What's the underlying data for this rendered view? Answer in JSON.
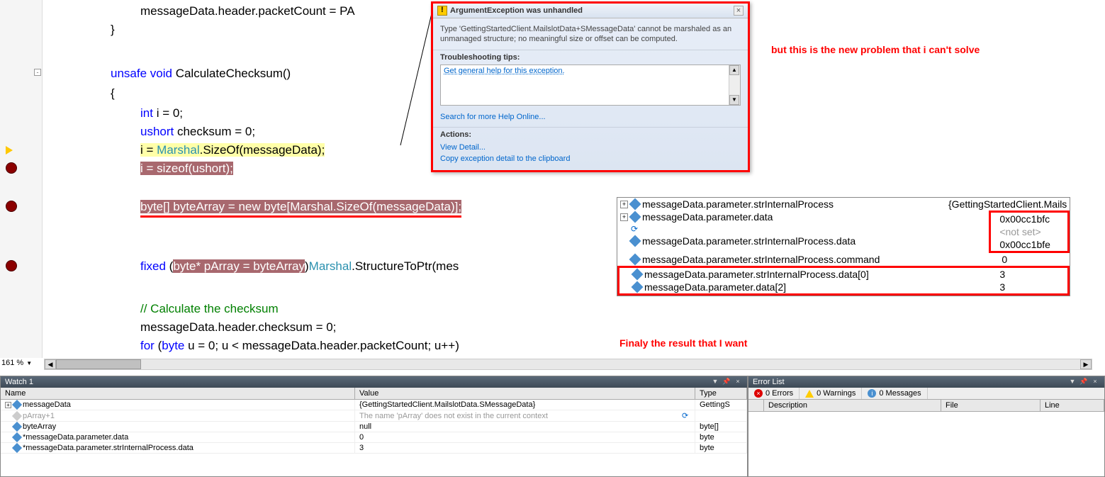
{
  "code": {
    "l1": "messageData.header.packetCount = PA",
    "l2": "}",
    "l3_kw1": "unsafe",
    "l3_kw2": "void",
    "l3_name": " CalculateChecksum()",
    "l4": "{",
    "l5_kw": "int",
    "l5_rest": " i = 0;",
    "l6_kw": "ushort",
    "l6_rest": " checksum = 0;",
    "l7_a": "i = ",
    "l7_b": "Marshal",
    "l7_c": ".SizeOf(messageData);",
    "l8_a": "i",
    "l8_b": " = ",
    "l8_c": "sizeof",
    "l8_d": "(",
    "l8_e": "ushort",
    "l8_f": ");",
    "l9_a": "byte",
    "l9_b": "[] byteArray = ",
    "l9_c": "new",
    "l9_d": " ",
    "l9_e": "byte",
    "l9_f": "[",
    "l9_g": "Marshal",
    "l9_h": ".SizeOf(messageData)];",
    "l10_kw": "fixed",
    "l10_a": " (",
    "l10_b": "byte",
    "l10_c": "* pArray = byteArray",
    "l10_d": ")",
    "l10_e": "Marshal",
    "l10_f": ".StructureToPtr(mes",
    "l11": "// Calculate the checksum",
    "l12": "messageData.header.checksum = 0;",
    "l13_kw": "for",
    "l13_a": " (",
    "l13_b": "byte",
    "l13_c": " u = 0; u < messageData.header.packetCount; u++)"
  },
  "popup": {
    "title": "ArgumentException was unhandled",
    "body": "Type 'GettingStartedClient.MailslotData+SMessageData' cannot be marshaled as an unmanaged structure; no meaningful size or offset can be computed.",
    "tips_title": "Troubleshooting tips:",
    "tip1": "Get general help for this exception.",
    "search": "Search for more Help Online...",
    "actions_title": "Actions:",
    "action1": "View Detail...",
    "action2": "Copy exception detail to the clipboard"
  },
  "anno1": "but  this is the new problem that i can't solve",
  "anno2": "Finaly the result that I want",
  "datatip": {
    "rows": [
      {
        "exp": "+",
        "name": "messageData.parameter.strInternalProcess",
        "val": "{GettingStartedClient.Mails"
      },
      {
        "exp": "+",
        "name": "messageData.parameter.data",
        "val": "0x00cc1bfc"
      },
      {
        "exp": "r",
        "name": "",
        "val": "<not set>"
      },
      {
        "exp": "",
        "name": "messageData.parameter.strInternalProcess.data",
        "val": "0x00cc1bfe"
      },
      {
        "exp": "",
        "name": "messageData.parameter.strInternalProcess.command",
        "val": "0"
      },
      {
        "exp": "",
        "name": "messageData.parameter.strInternalProcess.data[0]",
        "val": "3"
      },
      {
        "exp": "",
        "name": "messageData.parameter.data[2]",
        "val": "3"
      }
    ]
  },
  "zoom": "161 %",
  "watch": {
    "title": "Watch 1",
    "cols": {
      "name": "Name",
      "value": "Value",
      "type": "Type"
    },
    "rows": [
      {
        "exp": "+",
        "name": "messageData",
        "value": "{GettingStartedClient.MailslotData.SMessageData}",
        "type": "GettingS"
      },
      {
        "exp": "",
        "grey": true,
        "name": "pArray+1",
        "value": "The name 'pArray' does not exist in the current context",
        "type": "",
        "refresh": true
      },
      {
        "exp": "",
        "name": "byteArray",
        "value": "null",
        "type": "byte[]"
      },
      {
        "exp": "",
        "name": "*messageData.parameter.data",
        "value": "0",
        "type": "byte"
      },
      {
        "exp": "",
        "name": "*messageData.parameter.strInternalProcess.data",
        "value": "3",
        "type": "byte"
      }
    ]
  },
  "errorlist": {
    "title": "Error List",
    "tabs": {
      "errors": "0 Errors",
      "warnings": "0 Warnings",
      "messages": "0 Messages"
    },
    "cols": {
      "desc": "Description",
      "file": "File",
      "line": "Line"
    }
  }
}
